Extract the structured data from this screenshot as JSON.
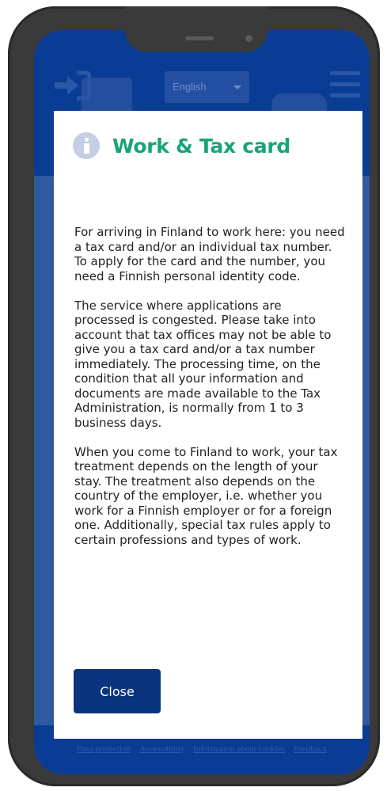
{
  "header": {
    "language": "English"
  },
  "modal": {
    "title": "Work & Tax card",
    "paragraphs": [
      "For arriving in Finland to work here: you need a tax card and/or an individual tax number. To apply for the card and the number, you need a Finnish personal identity code.",
      "The service where applications are processed is congested. Please take into account that tax offices may not be able to give you a tax card and/or a tax number immediately. The processing time, on the condition that all your information and documents are made available to the Tax Administration, is normally from 1 to 3 business days.",
      "When you come to Finland to work, your tax treatment depends on the length of your stay. The treatment also depends on the country of the employer, i.e. whether you work for a Finnish employer or for a foreign one. Additionally, special tax rules apply to certain professions and types of work."
    ],
    "close_label": "Close"
  },
  "footer": {
    "links": [
      "Data protection",
      "Accessibility",
      "Information about cookies",
      "Feedback"
    ]
  },
  "colors": {
    "header_blue": "#0a3c95",
    "title_green": "#1aa37a",
    "button_navy": "#0a347e",
    "phone_frame": "#3a3a3a"
  },
  "icons": [
    "login-icon",
    "menu-icon",
    "info-icon",
    "chevron-down-icon"
  ]
}
